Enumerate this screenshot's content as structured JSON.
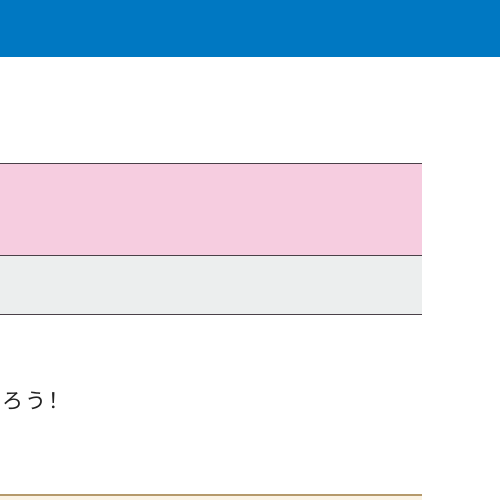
{
  "heading": {
    "text": "知ろう！"
  },
  "colors": {
    "header_bar": "#0078c2",
    "row_pink": "#f6cde0",
    "row_gray": "#eceeee",
    "row_border": "#4a4048",
    "box_border": "#b59a6c",
    "box_fill": "#fbf3e4"
  }
}
